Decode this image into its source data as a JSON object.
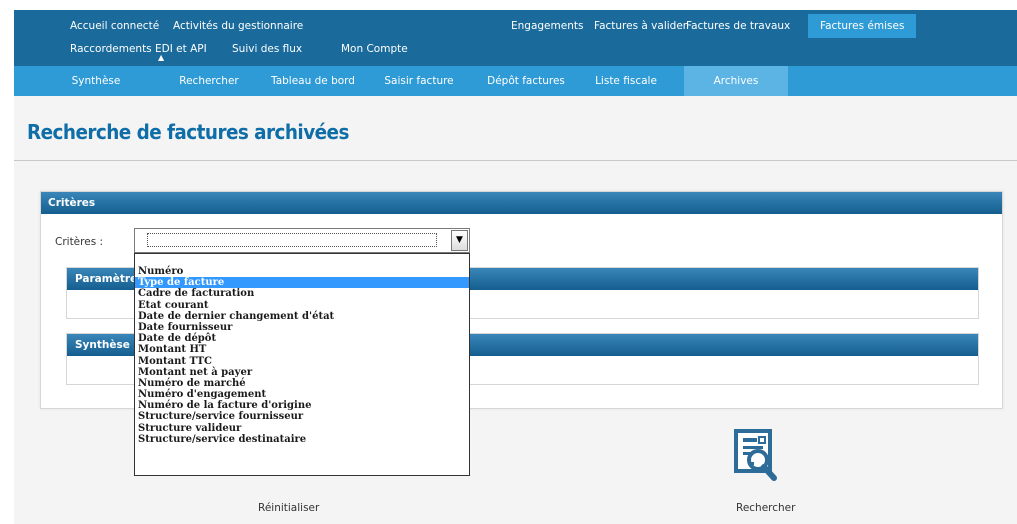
{
  "top_nav": {
    "row1_left": [
      "Accueil connecté",
      "Activités du gestionnaire"
    ],
    "row1_right": [
      "Engagements",
      "Factures à valider",
      "Factures de travaux",
      "Factures émises"
    ],
    "row2": [
      "Raccordements EDI et API",
      "Suivi des flux",
      "Mon Compte"
    ],
    "active": "Factures émises"
  },
  "sub_nav": {
    "items": [
      "Synthèse",
      "Rechercher",
      "Tableau de bord",
      "Saisir facture",
      "Dépôt factures",
      "Liste fiscale",
      "Archives"
    ],
    "active": "Archives"
  },
  "page": {
    "title": "Recherche de factures archivées"
  },
  "criteria_panel": {
    "header": "Critères",
    "label": "Critères :",
    "selected_value": ""
  },
  "sub_panels": {
    "parametres_header": "Paramètres",
    "synthese_header": "Synthèse de la recherche"
  },
  "dropdown": {
    "options": [
      "Numéro",
      "Type de facture",
      "Cadre de facturation",
      "Etat courant",
      "Date de dernier changement d'état",
      "Date fournisseur",
      "Date de dépôt",
      "Montant HT",
      "Montant TTC",
      "Montant net à payer",
      "Numéro de marché",
      "Numéro d'engagement",
      "Numéro de la facture d'origine",
      "Structure/service fournisseur",
      "Structure valideur",
      "Structure/service destinataire"
    ],
    "highlighted": "Type de facture"
  },
  "actions": {
    "reset_label": "Réinitialiser",
    "search_label": "Rechercher"
  },
  "colors": {
    "top_nav": "#1a6b9c",
    "sub_nav": "#2e9bd7",
    "active_tab": "#5cb4e4",
    "title": "#0f6da8",
    "highlight": "#3399ff"
  },
  "icons": {
    "select_arrow": "chevron-down-icon",
    "search": "document-magnifier-icon",
    "menu_caret": "caret-up-icon"
  }
}
